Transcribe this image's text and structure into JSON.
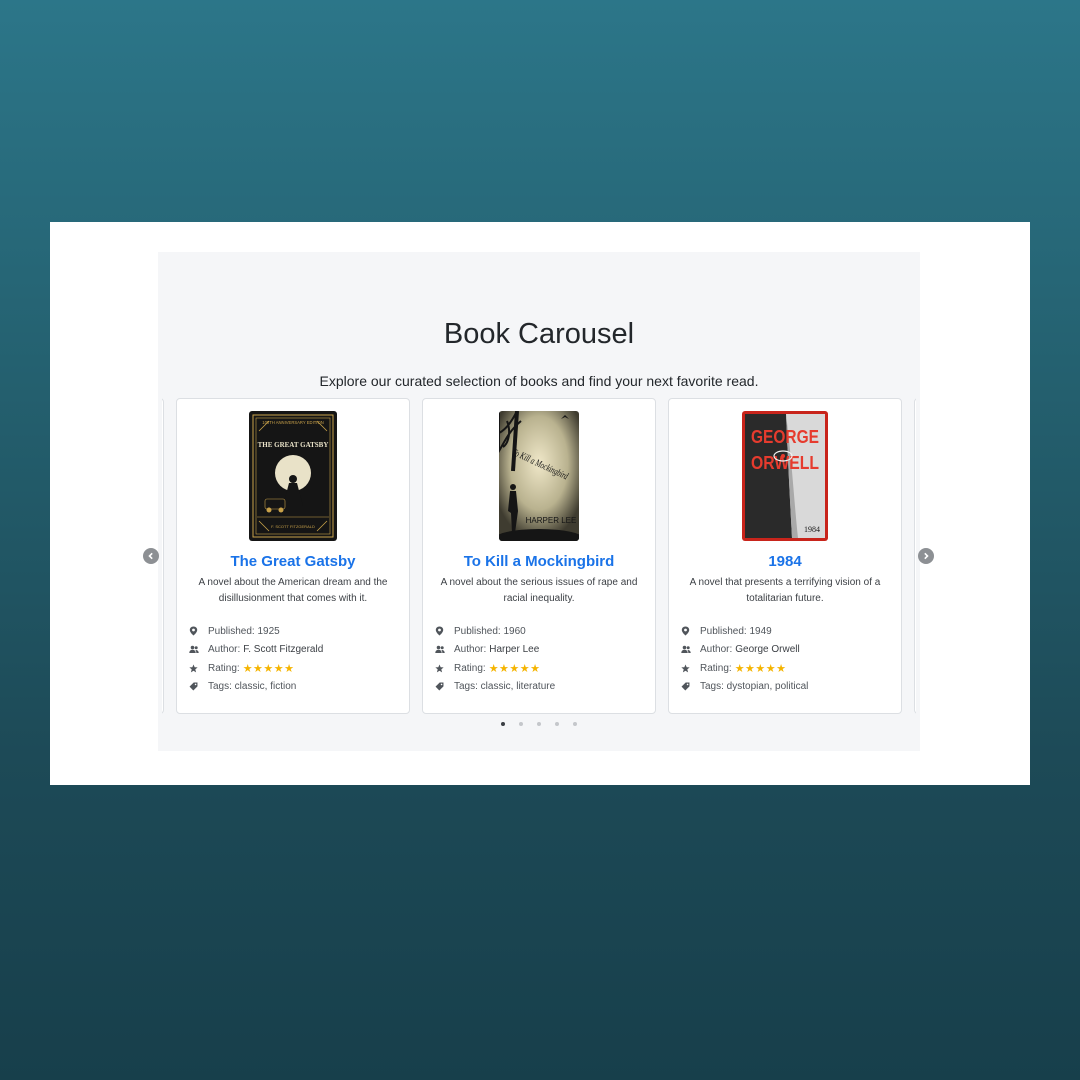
{
  "carousel": {
    "title": "Book Carousel",
    "subtitle": "Explore our curated selection of books and find your next favorite read.",
    "books": [
      {
        "title": "The Great Gatsby",
        "description": "A novel about the American dream and the disillusionment that comes with it.",
        "published_label": "Published: 1925",
        "author_label": "Author:",
        "author": "F. Scott Fitzgerald",
        "rating_label": "Rating:",
        "stars": "★★★★★",
        "tags_label": "Tags: classic, fiction",
        "cover_top_text": "100TH ANNIVERSARY EDITION",
        "cover_title": "THE GREAT GATSBY",
        "cover_author": "F. SCOTT FITZGERALD"
      },
      {
        "title": "To Kill a Mockingbird",
        "description": "A novel about the serious issues of rape and racial inequality.",
        "published_label": "Published: 1960",
        "author_label": "Author:",
        "author": "Harper Lee",
        "rating_label": "Rating:",
        "stars": "★★★★★",
        "tags_label": "Tags: classic, literature",
        "cover_title": "To Kill a Mockingbird",
        "cover_author": "HARPER LEE"
      },
      {
        "title": "1984",
        "description": "A novel that presents a terrifying vision of a totalitarian future.",
        "published_label": "Published: 1949",
        "author_label": "Author:",
        "author": "George Orwell",
        "rating_label": "Rating:",
        "stars": "★★★★★",
        "tags_label": "Tags: dystopian, political",
        "cover_title_1": "GEORGE",
        "cover_title_2": "ORWELL",
        "cover_year": "1984"
      }
    ],
    "dots_count": 5,
    "active_dot": 1
  },
  "icons": {
    "published": "location-pin-icon",
    "author": "people-icon",
    "rating": "star-icon",
    "tags": "tag-icon",
    "prev": "chevron-left-icon",
    "next": "chevron-right-icon"
  },
  "colors": {
    "title_link": "#1a73e8",
    "stars": "#f5b400",
    "arrow": "#8d9094",
    "background_top": "#2c7689",
    "background_bottom": "#173f4b"
  }
}
